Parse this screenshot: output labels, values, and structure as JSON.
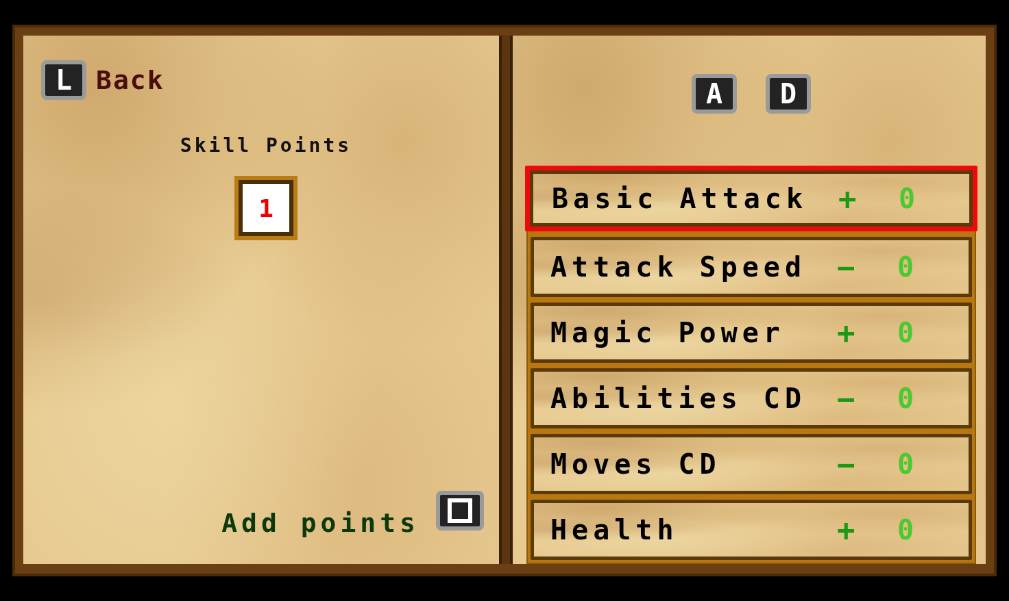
{
  "back": {
    "key": "L",
    "label": "Back"
  },
  "skill_points": {
    "label": "Skill Points",
    "value": "1"
  },
  "add_points": {
    "label": "Add points"
  },
  "tab_keys": [
    "A",
    "D"
  ],
  "stats": [
    {
      "name": "Basic Attack",
      "sign": "+",
      "value": "0",
      "selected": true
    },
    {
      "name": "Attack Speed",
      "sign": "−",
      "value": "0",
      "selected": false
    },
    {
      "name": "Magic Power",
      "sign": "+",
      "value": "0",
      "selected": false
    },
    {
      "name": "Abilities CD",
      "sign": "−",
      "value": "0",
      "selected": false
    },
    {
      "name": "Moves CD",
      "sign": "−",
      "value": "0",
      "selected": false
    },
    {
      "name": "Health",
      "sign": "+",
      "value": "0",
      "selected": false
    }
  ]
}
